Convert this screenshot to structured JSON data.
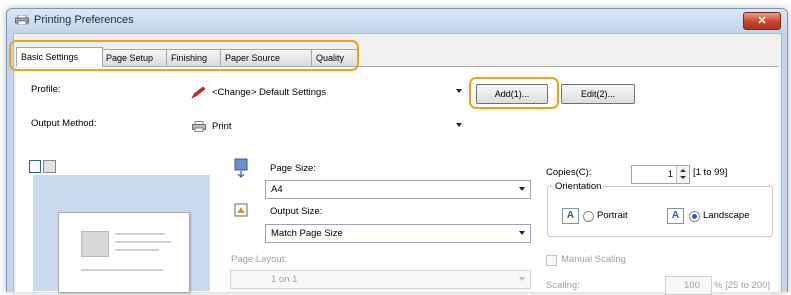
{
  "window": {
    "title": "Printing Preferences",
    "close_glyph": "✕"
  },
  "tabs": [
    {
      "label": "Basic Settings",
      "active": true
    },
    {
      "label": "Page Setup"
    },
    {
      "label": "Finishing"
    },
    {
      "label": "Paper Source"
    },
    {
      "label": "Quality"
    }
  ],
  "profile": {
    "label": "Profile:",
    "value": "<Change> Default Settings",
    "add_label": "Add(1)...",
    "edit_label": "Edit(2)..."
  },
  "output_method": {
    "label": "Output Method:",
    "value": "Print"
  },
  "page_size": {
    "label": "Page Size:",
    "value": "A4"
  },
  "output_size": {
    "label": "Output Size:",
    "value": "Match Page Size"
  },
  "page_layout": {
    "label": "Page Layout:",
    "value": "1 on 1"
  },
  "copies": {
    "label": "Copies(C):",
    "value": "1",
    "range": "[1 to 99]"
  },
  "orientation": {
    "label": "Orientation",
    "portrait": "Portrait",
    "landscape": "Landscape",
    "selected": "Landscape"
  },
  "manual_scaling": {
    "label": "Manual Scaling"
  },
  "scaling": {
    "label": "Scaling:",
    "value": "100",
    "range": "% [25 to 200]"
  },
  "colors": {
    "highlight": "#f0a11a",
    "accent": "#1d5fb5"
  }
}
